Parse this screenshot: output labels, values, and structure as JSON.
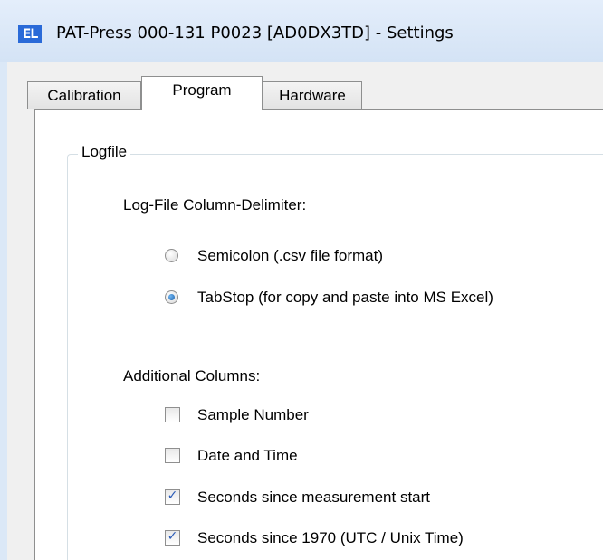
{
  "window": {
    "app_icon_text": "EL",
    "title": "PAT-Press 000-131 P0023 [AD0DX3TD] - Settings"
  },
  "tabs": [
    {
      "label": "Calibration",
      "active": false
    },
    {
      "label": "Program",
      "active": true
    },
    {
      "label": "Hardware",
      "active": false
    }
  ],
  "logfile": {
    "group_title": "Logfile",
    "delimiter_label": "Log-File Column-Delimiter:",
    "delimiter_options": [
      {
        "label": "Semicolon (.csv file format)",
        "selected": false
      },
      {
        "label": "TabStop (for copy and paste into MS Excel)",
        "selected": true
      }
    ],
    "additional_columns_label": "Additional Columns:",
    "additional_columns": [
      {
        "label": "Sample Number",
        "checked": false
      },
      {
        "label": "Date and Time",
        "checked": false
      },
      {
        "label": "Seconds since measurement start",
        "checked": true
      },
      {
        "label": "Seconds since 1970 (UTC / Unix Time)",
        "checked": true
      }
    ]
  },
  "colors": {
    "titlebar": "#dbe8f7",
    "dialog_background": "#f0f0f0",
    "panel_background": "#ffffff",
    "accent": "#2a6ad8"
  }
}
